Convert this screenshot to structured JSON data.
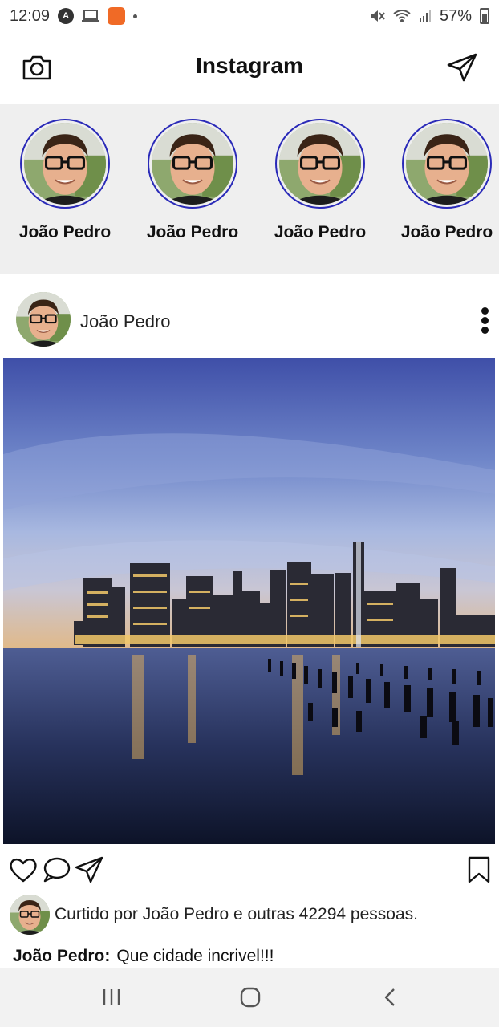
{
  "status_bar": {
    "time": "12:09",
    "battery": "57%",
    "icons": [
      "android-auto-icon",
      "laptop-icon",
      "app-notification-icon",
      "dot-icon",
      "mute-icon",
      "wifi-icon",
      "signal-icon",
      "battery-icon"
    ]
  },
  "header": {
    "title": "Instagram",
    "left_icon": "camera-icon",
    "right_icon": "send-icon"
  },
  "stories": [
    {
      "name": "João Pedro"
    },
    {
      "name": "João Pedro"
    },
    {
      "name": "João Pedro"
    },
    {
      "name": "João Pedro"
    }
  ],
  "post": {
    "username": "João Pedro",
    "image_subject": "city-skyline-photo",
    "likes_text": "Curtido por João Pedro e outras 42294 pessoas.",
    "caption_user": "João Pedro:",
    "caption_text": "Que cidade incrivel!!!",
    "actions": [
      "heart-icon",
      "comment-icon",
      "share-icon",
      "bookmark-icon"
    ]
  },
  "nav": {
    "icons": [
      "recent-apps-icon",
      "home-icon",
      "back-icon"
    ]
  },
  "colors": {
    "story_ring": "#2a2ab8",
    "stories_bg": "#efefef",
    "nav_bg": "#f2f2f2"
  }
}
